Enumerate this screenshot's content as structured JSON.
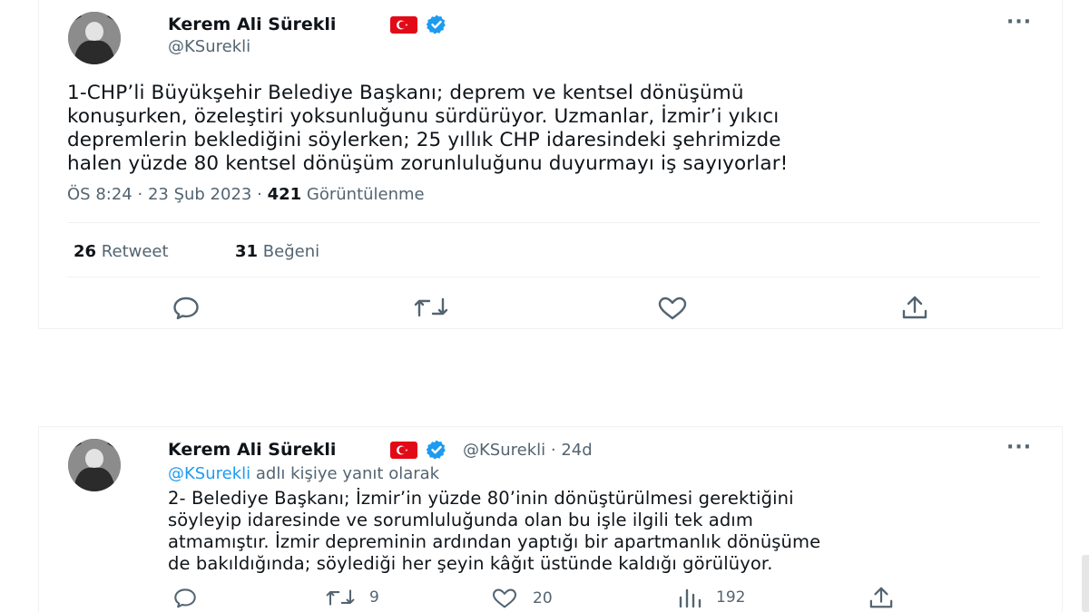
{
  "tweet1": {
    "author_name": "Kerem Ali Sürekli",
    "author_handle": "@KSurekli",
    "more_label": "···",
    "text_lines": [
      "1-CHP’li Büyükşehir Belediye Başkanı; deprem ve kentsel dönüşümü",
      "konuşurken, özeleştiri yoksunluğunu sürdürüyor. Uzmanlar, İzmir’i yıkıcı",
      "depremlerin beklediğini söylerken; 25 yıllık CHP idaresindeki şehrimizde",
      "halen yüzde 80 kentsel dönüşüm zorunluluğunu duyurmayı iş sayıyorlar!"
    ],
    "time": "ÖS 8:24",
    "date": "23 Şub 2023",
    "sep": "·",
    "views_count": "421",
    "views_label": "Görüntülenme",
    "retweets_count": "26",
    "retweets_label": "Retweet",
    "likes_count": "31",
    "likes_label": "Beğeni",
    "icons": [
      "reply-icon",
      "retweet-icon",
      "like-icon",
      "share-icon"
    ]
  },
  "tweet2": {
    "author_name": "Kerem Ali Sürekli",
    "author_handle": "@KSurekli",
    "sep": "·",
    "age": "24d",
    "more_label": "···",
    "reply_mention": "@KSurekli",
    "reply_suffix": "adlı kişiye yanıt olarak",
    "text_lines": [
      "2- Belediye Başkanı; İzmir’in yüzde 80’inin dönüştürülmesi gerektiğini",
      "söyleyip idaresinde ve sorumluluğunda olan bu işle ilgili tek adım",
      "atmamıştır. İzmir depreminin ardından yaptığı bir apartmanlık dönüşüme",
      "de bakıldığında; söylediği her şeyin kâğıt üstünde kaldığı görülüyor."
    ],
    "retweets": "9",
    "likes": "20",
    "views": "192",
    "icons": [
      "reply-icon",
      "retweet-icon",
      "like-icon",
      "views-icon",
      "share-icon"
    ]
  },
  "colors": {
    "text": "#0f1419",
    "secondary": "#536471",
    "link": "#1d9bf0",
    "verified": "#1d9bf0",
    "flag_red": "#e30a17",
    "border": "#eff3f4"
  }
}
